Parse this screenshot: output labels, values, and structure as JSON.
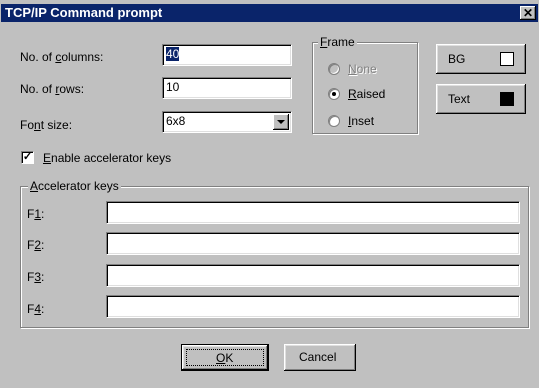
{
  "window": {
    "title": "TCP/IP Command prompt",
    "close_glyph": "✕"
  },
  "fields": {
    "columns": {
      "label_pre": "No. of ",
      "label_ul": "c",
      "label_post": "olumns:",
      "value": "40"
    },
    "rows": {
      "label_pre": "No. of ",
      "label_ul": "r",
      "label_post": "ows:",
      "value": "10"
    },
    "font": {
      "label_pre": "Fo",
      "label_ul": "n",
      "label_post": "t size:",
      "value": "6x8"
    }
  },
  "frame": {
    "label_ul": "F",
    "label_post": "rame",
    "options": [
      {
        "ul": "N",
        "rest": "one",
        "checked": false,
        "disabled": true
      },
      {
        "ul": "R",
        "rest": "aised",
        "checked": true,
        "disabled": false
      },
      {
        "ul": "I",
        "rest": "nset",
        "checked": false,
        "disabled": false
      }
    ]
  },
  "color_buttons": {
    "bg": {
      "label": "BG",
      "swatch_color": "#ffffff"
    },
    "text": {
      "label": "Text",
      "swatch_color": "#000000"
    }
  },
  "accelerator": {
    "enable_pre": "",
    "enable_ul": "E",
    "enable_post": "nable accelerator keys",
    "enabled": true,
    "check_glyph": "✓",
    "group_ul": "A",
    "group_post": "ccelerator keys",
    "keys": [
      {
        "pre": "F",
        "ul": "1",
        "post": ":",
        "value": ""
      },
      {
        "pre": "F",
        "ul": "2",
        "post": ":",
        "value": ""
      },
      {
        "pre": "F",
        "ul": "3",
        "post": ":",
        "value": ""
      },
      {
        "pre": "F",
        "ul": "4",
        "post": ":",
        "value": ""
      }
    ]
  },
  "buttons": {
    "ok": {
      "ul": "O",
      "rest": "K"
    },
    "cancel": "Cancel"
  }
}
